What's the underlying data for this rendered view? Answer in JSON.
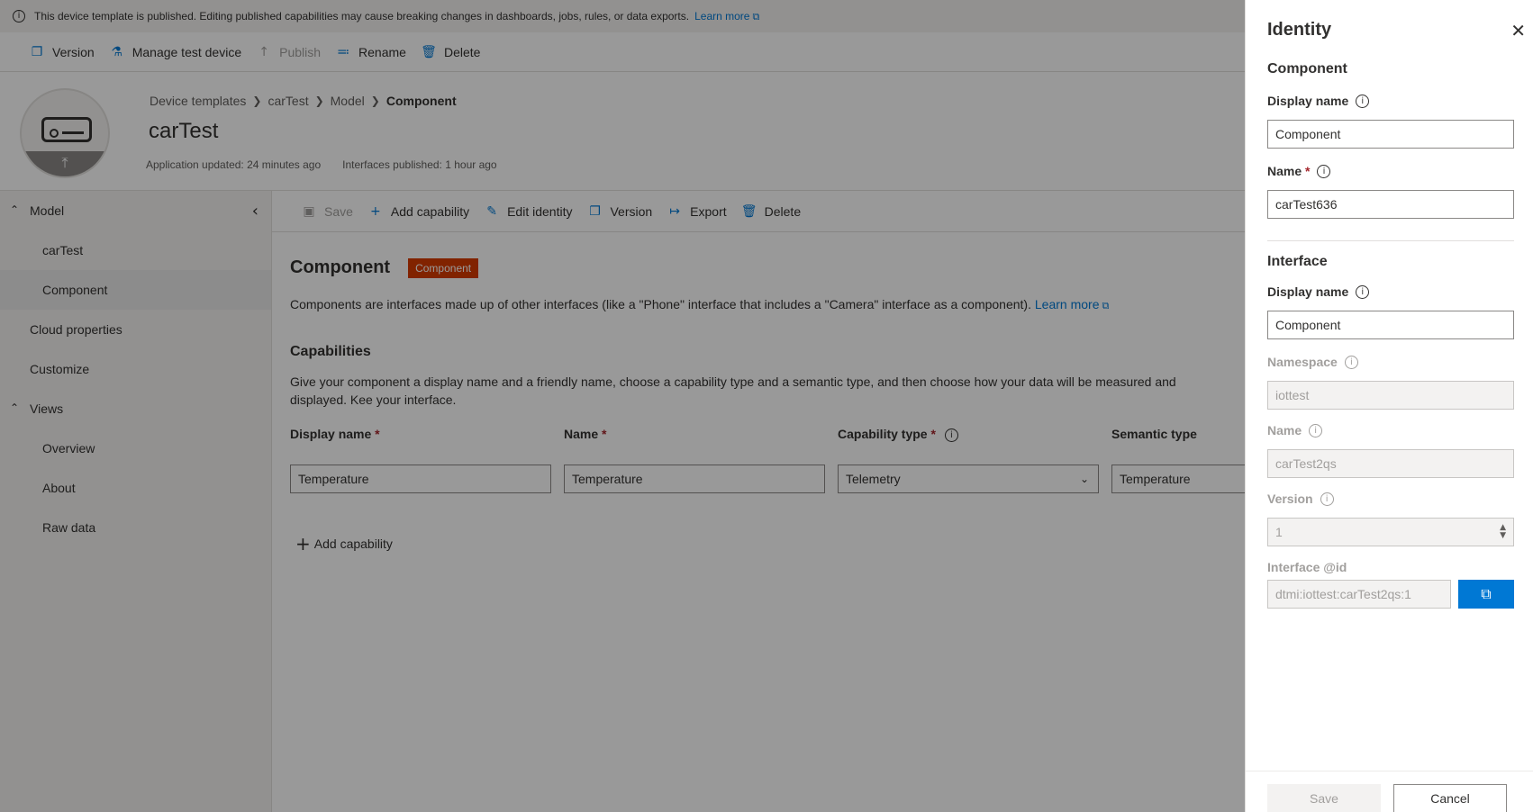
{
  "banner": {
    "text": "This device template is published. Editing published capabilities may cause breaking changes in dashboards, jobs, rules, or data exports.",
    "link": "Learn more"
  },
  "topbar": {
    "version": "Version",
    "manage_test_device": "Manage test device",
    "publish": "Publish",
    "rename": "Rename",
    "delete": "Delete"
  },
  "header": {
    "breadcrumb": [
      "Device templates",
      "carTest",
      "Model",
      "Component"
    ],
    "title": "carTest",
    "app_updated": "Application updated: 24 minutes ago",
    "interfaces_published": "Interfaces published: 1 hour ago"
  },
  "nav": {
    "model": "Model",
    "cartest": "carTest",
    "component": "Component",
    "cloud_properties": "Cloud properties",
    "customize": "Customize",
    "views": "Views",
    "overview": "Overview",
    "about": "About",
    "raw_data": "Raw data"
  },
  "content_toolbar": {
    "save": "Save",
    "add_capability": "Add capability",
    "edit_identity": "Edit identity",
    "version": "Version",
    "export": "Export",
    "delete": "Delete"
  },
  "component": {
    "title": "Component",
    "badge": "Component",
    "description": "Components are interfaces made up of other interfaces (like a \"Phone\" interface that includes a \"Camera\" interface as a component).",
    "learn_more": "Learn more"
  },
  "capabilities": {
    "title": "Capabilities",
    "description": "Give your component a display name and a friendly name, choose a capability type and a semantic type, and then choose how your data will be measured and displayed. Kee your interface.",
    "columns": {
      "display_name": "Display name",
      "name": "Name",
      "capability_type": "Capability type",
      "semantic_type": "Semantic type"
    },
    "row": {
      "display_name": "Temperature",
      "name": "Temperature",
      "capability_type": "Telemetry",
      "semantic_type": "Temperature"
    },
    "add_capability": "Add capability"
  },
  "panel": {
    "title": "Identity",
    "component_section": "Component",
    "comp_display_name_label": "Display name",
    "comp_display_name": "Component",
    "comp_name_label": "Name",
    "comp_name": "carTest636",
    "interface_section": "Interface",
    "int_display_name_label": "Display name",
    "int_display_name": "Component",
    "namespace_label": "Namespace",
    "namespace": "iottest",
    "int_name_label": "Name",
    "int_name": "carTest2qs",
    "version_label": "Version",
    "version": "1",
    "interface_id_label": "Interface @id",
    "interface_id": "dtmi:iottest:carTest2qs:1",
    "save": "Save",
    "cancel": "Cancel"
  },
  "colors": {
    "accent": "#0078d4",
    "badge": "#d83b01",
    "overlay": "rgba(0,0,0,0.4)"
  }
}
